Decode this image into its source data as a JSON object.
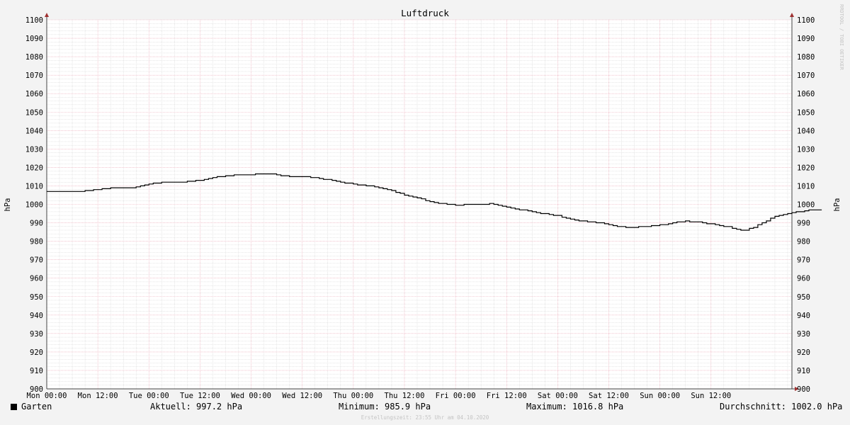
{
  "chart_data": {
    "type": "line",
    "title": "Luftdruck",
    "ylabel": "hPa",
    "ylim": [
      900,
      1100
    ],
    "ytick_step": 10,
    "yticks": [
      "900",
      "910",
      "920",
      "930",
      "940",
      "950",
      "960",
      "970",
      "980",
      "990",
      "1000",
      "1010",
      "1020",
      "1030",
      "1040",
      "1050",
      "1060",
      "1070",
      "1080",
      "1090",
      "1100"
    ],
    "x_labels": [
      "Mon 00:00",
      "Mon 12:00",
      "Tue 00:00",
      "Tue 12:00",
      "Wed 00:00",
      "Wed 12:00",
      "Thu 00:00",
      "Thu 12:00",
      "Fri 00:00",
      "Fri 12:00",
      "Sat 00:00",
      "Sat 12:00",
      "Sun 00:00",
      "Sun 12:00"
    ],
    "x_unit": "hours since Mon 00:00",
    "xlim": [
      0,
      168
    ],
    "watermark": "RRDTOOL / TOBI OETIKER",
    "series": [
      {
        "name": "Garten",
        "color": "#000000",
        "points": [
          [
            0,
            1007.0
          ],
          [
            4,
            1007.0
          ],
          [
            8,
            1007.0
          ],
          [
            12,
            1008.0
          ],
          [
            16,
            1009.0
          ],
          [
            20,
            1009.2
          ],
          [
            24,
            1011.0
          ],
          [
            28,
            1012.0
          ],
          [
            32,
            1012.2
          ],
          [
            36,
            1013.0
          ],
          [
            40,
            1015.0
          ],
          [
            44,
            1015.8
          ],
          [
            48,
            1016.2
          ],
          [
            50,
            1016.6
          ],
          [
            53,
            1016.3
          ],
          [
            56,
            1015.3
          ],
          [
            60,
            1015.0
          ],
          [
            64,
            1014.2
          ],
          [
            68,
            1012.3
          ],
          [
            72,
            1011.0
          ],
          [
            76,
            1009.8
          ],
          [
            80,
            1008.0
          ],
          [
            84,
            1005.0
          ],
          [
            88,
            1002.8
          ],
          [
            92,
            1000.5
          ],
          [
            96,
            999.6
          ],
          [
            100,
            999.9
          ],
          [
            104,
            1000.3
          ],
          [
            108,
            998.5
          ],
          [
            112,
            996.8
          ],
          [
            116,
            995.2
          ],
          [
            120,
            993.8
          ],
          [
            124,
            991.3
          ],
          [
            128,
            990.5
          ],
          [
            132,
            989.0
          ],
          [
            136,
            987.4
          ],
          [
            140,
            988.0
          ],
          [
            144,
            988.8
          ],
          [
            147,
            990.0
          ],
          [
            150,
            990.8
          ],
          [
            154,
            990.2
          ],
          [
            157,
            988.8
          ],
          [
            160,
            987.8
          ],
          [
            162,
            986.5
          ],
          [
            164,
            985.9
          ],
          [
            166,
            987.6
          ],
          [
            168,
            989.9
          ],
          [
            170,
            992.5
          ],
          [
            172,
            994.0
          ],
          [
            176,
            995.8
          ],
          [
            180,
            997.2
          ],
          [
            182,
            997.2
          ]
        ]
      }
    ]
  },
  "legend": {
    "series_name": "Garten",
    "current": "Aktuell: 997.2 hPa",
    "minimum": "Minimum: 985.9 hPa",
    "maximum": "Maximum: 1016.8 hPa",
    "average": "Durchschnitt: 1002.0 hPa"
  },
  "footer": "Erstellungszeit: 23:55 Uhr am 04.10.2020",
  "colors": {
    "background": "#f3f3f3",
    "plot_background": "#ffffff",
    "minor_grid": "#c8c8c8",
    "major_grid": "#e9a0b0",
    "axis": "#a03030"
  }
}
